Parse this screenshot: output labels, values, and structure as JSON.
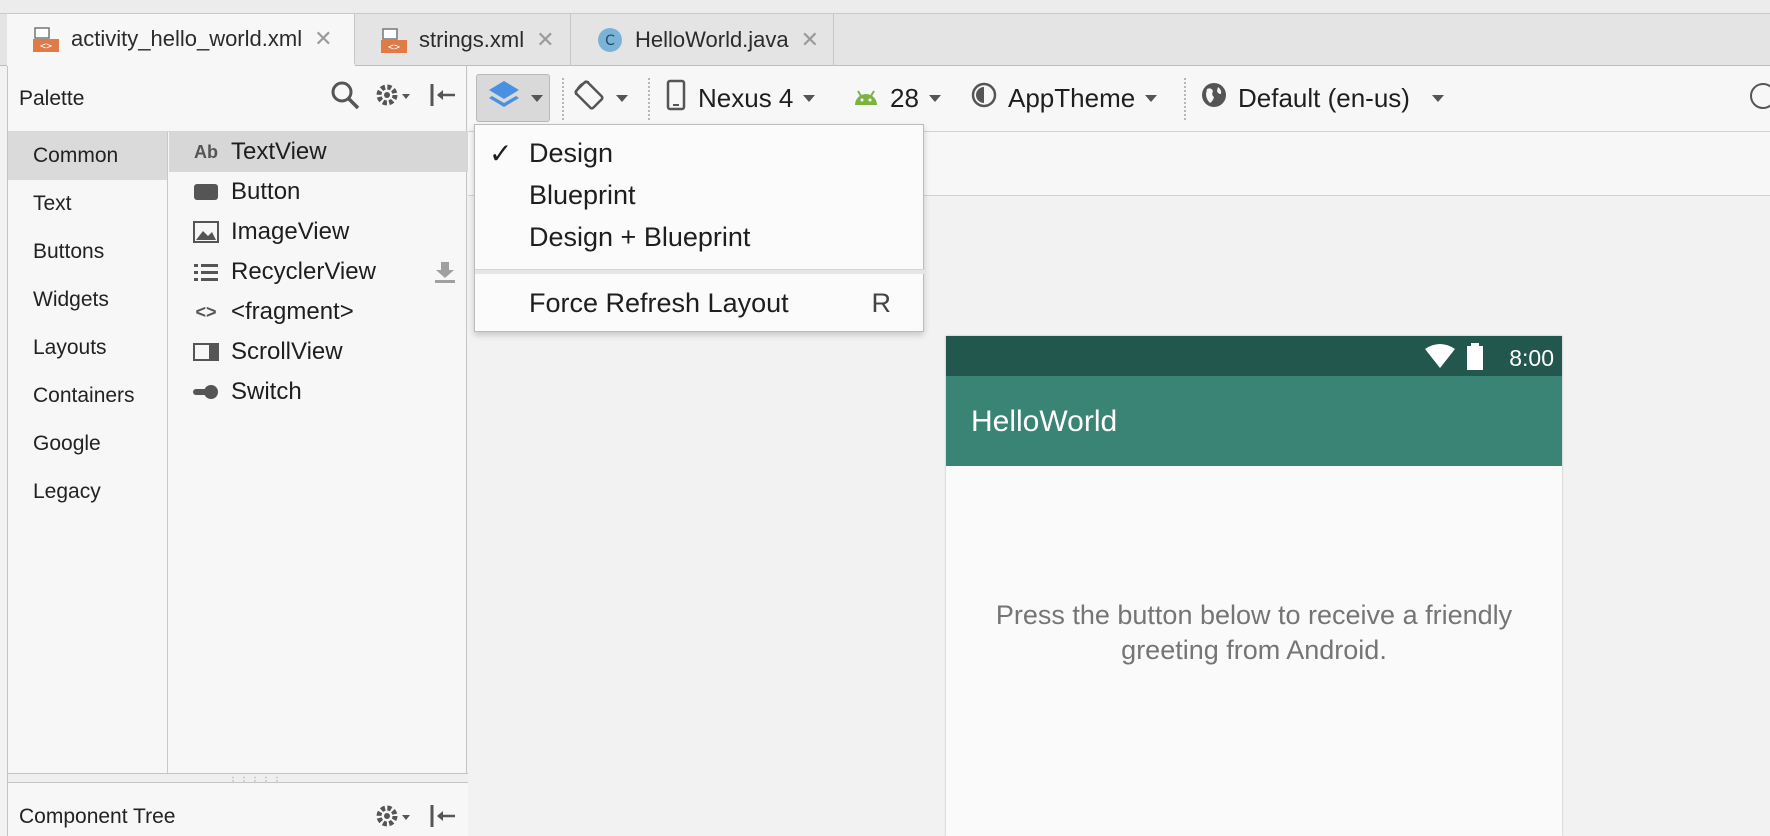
{
  "tabs": [
    {
      "label": "activity_hello_world.xml",
      "icon": "xml-file-icon",
      "active": true
    },
    {
      "label": "strings.xml",
      "icon": "xml-file-icon",
      "active": false
    },
    {
      "label": "HelloWorld.java",
      "icon": "java-class-icon",
      "active": false
    }
  ],
  "palette": {
    "title": "Palette",
    "categories": [
      "Common",
      "Text",
      "Buttons",
      "Widgets",
      "Layouts",
      "Containers",
      "Google",
      "Legacy"
    ],
    "selected_category": "Common",
    "items": [
      {
        "label": "TextView",
        "icon": "textview-icon",
        "glyph": "Ab"
      },
      {
        "label": "Button",
        "icon": "button-icon"
      },
      {
        "label": "ImageView",
        "icon": "image-icon"
      },
      {
        "label": "RecyclerView",
        "icon": "list-icon"
      },
      {
        "label": "<fragment>",
        "icon": "code-icon",
        "glyph": "<>"
      },
      {
        "label": "ScrollView",
        "icon": "scrollview-icon"
      },
      {
        "label": "Switch",
        "icon": "switch-icon"
      }
    ]
  },
  "component_tree": {
    "title": "Component Tree"
  },
  "toolbar": {
    "device": "Nexus 4",
    "api": "28",
    "theme": "AppTheme",
    "locale": "Default (en-us)"
  },
  "menu": {
    "items": [
      {
        "label": "Design",
        "checked": true
      },
      {
        "label": "Blueprint",
        "checked": false
      },
      {
        "label": "Design + Blueprint",
        "checked": false
      }
    ],
    "refresh": {
      "label": "Force Refresh Layout",
      "shortcut": "R"
    },
    "check_glyph": "✓"
  },
  "phone": {
    "time": "8:00",
    "app_title": "HelloWorld",
    "body_text": "Press the button below to receive a friendly greeting from Android.",
    "colors": {
      "status": "#22574d",
      "appbar": "#3a8475"
    }
  }
}
